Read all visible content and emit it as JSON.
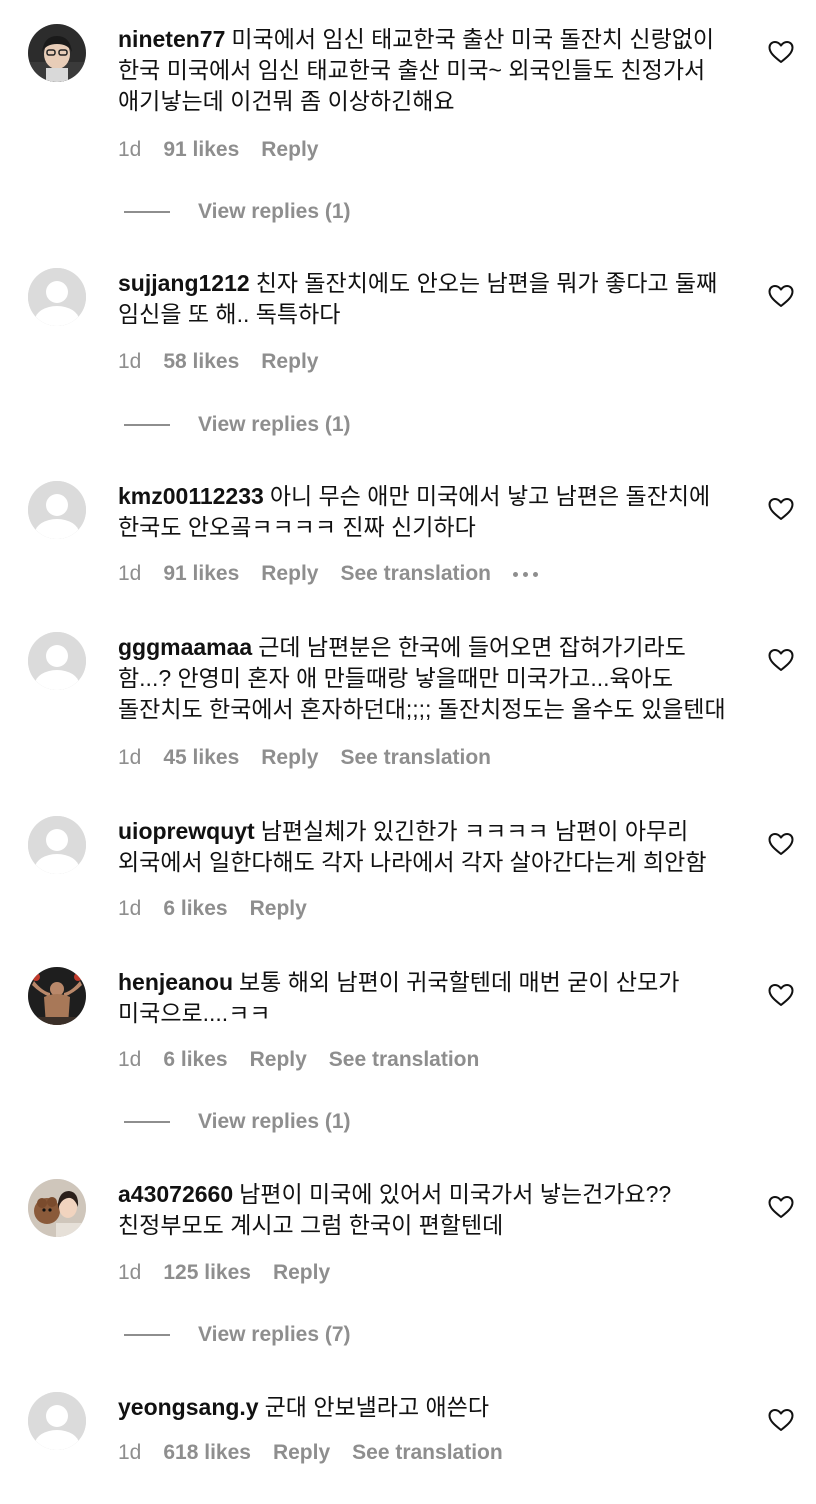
{
  "ui": {
    "colors": {
      "text": "#111111",
      "muted": "#8e8e8e",
      "background": "#ffffff",
      "avatar_placeholder": "#dbdbdb"
    },
    "icons": {
      "like": "heart-outline-icon",
      "more": "ellipsis-icon",
      "avatar_default": "default-user-icon"
    }
  },
  "comments": [
    {
      "username": "nineten77",
      "text": "미국에서 임신 태교한국 출산 미국 돌잔치 신랑없이 한국 미국에서 임신 태교한국 출산 미국~ 외국인들도 친정가서 애기낳는데 이건뭐 좀 이상하긴해요",
      "time": "1d",
      "likes": "91 likes",
      "reply": "Reply",
      "view_replies": "View replies (1)"
    },
    {
      "username": "sujjang1212",
      "text": "친자 돌잔치에도 안오는 남편을 뭐가 좋다고 둘째 임신을 또 해.. 독특하다",
      "time": "1d",
      "likes": "58 likes",
      "reply": "Reply",
      "view_replies": "View replies (1)"
    },
    {
      "username": "kmz00112233",
      "text": "아니 무슨 애만 미국에서 낳고 남편은 돌잔치에 한국도 안오곸ㅋㅋㅋㅋ 진짜 신기하다",
      "time": "1d",
      "likes": "91 likes",
      "reply": "Reply",
      "see_translation": "See translation"
    },
    {
      "username": "gggmaamaa",
      "text": "근데 남편분은 한국에 들어오면 잡혀가기라도 함...? 안영미 혼자 애 만들때랑 낳을때만 미국가고...육아도 돌잔치도 한국에서 혼자하던대;;;; 돌잔치정도는 올수도 있을텐대",
      "time": "1d",
      "likes": "45 likes",
      "reply": "Reply",
      "see_translation": "See translation"
    },
    {
      "username": "uioprewquyt",
      "text": "남편실체가 있긴한가 ㅋㅋㅋㅋ 남편이 아무리 외국에서 일한다해도 각자 나라에서 각자 살아간다는게 희안함",
      "time": "1d",
      "likes": "6 likes",
      "reply": "Reply"
    },
    {
      "username": "henjeanou",
      "text": "보통 해외 남편이 귀국할텐데 매번 굳이 산모가 미국으로....ㅋㅋ",
      "time": "1d",
      "likes": "6 likes",
      "reply": "Reply",
      "see_translation": "See translation",
      "view_replies": "View replies (1)"
    },
    {
      "username": "a43072660",
      "text": "남편이 미국에 있어서 미국가서 낳는건가요??친정부모도 계시고 그럼 한국이 편할텐데",
      "time": "1d",
      "likes": "125 likes",
      "reply": "Reply",
      "view_replies": "View replies (7)"
    },
    {
      "username": "yeongsang.y",
      "text": "군대 안보낼라고 애쓴다",
      "time": "1d",
      "likes": "618 likes",
      "reply": "Reply",
      "see_translation": "See translation"
    }
  ]
}
